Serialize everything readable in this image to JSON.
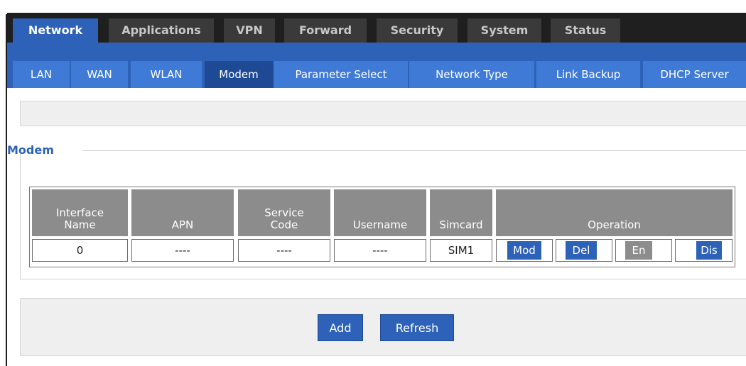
{
  "main_nav": {
    "tabs": [
      {
        "label": "Network",
        "active": true
      },
      {
        "label": "Applications",
        "active": false
      },
      {
        "label": "VPN",
        "active": false
      },
      {
        "label": "Forward",
        "active": false
      },
      {
        "label": "Security",
        "active": false
      },
      {
        "label": "System",
        "active": false
      },
      {
        "label": "Status",
        "active": false
      }
    ]
  },
  "sub_nav": {
    "tabs": [
      {
        "label": "LAN",
        "active": false
      },
      {
        "label": "WAN",
        "active": false
      },
      {
        "label": "WLAN",
        "active": false
      },
      {
        "label": "Modem",
        "active": true
      },
      {
        "label": "Parameter Select",
        "active": false
      },
      {
        "label": "Network Type",
        "active": false
      },
      {
        "label": "Link Backup",
        "active": false
      },
      {
        "label": "DHCP Server",
        "active": false
      }
    ]
  },
  "section": {
    "title": "Modem"
  },
  "table": {
    "headers": {
      "interface_name": "Interface\nName",
      "apn": "APN",
      "service_code": "Service\nCode",
      "username": "Username",
      "simcard": "Simcard",
      "operation": "Operation"
    },
    "rows": [
      {
        "interface_name": "0",
        "apn": "----",
        "service_code": "----",
        "username": "----",
        "simcard": "SIM1",
        "operations": {
          "mod": "Mod",
          "del": "Del",
          "en": "En",
          "dis": "Dis"
        }
      }
    ]
  },
  "actions": {
    "add_label": "Add",
    "refresh_label": "Refresh"
  },
  "colors": {
    "accent": "#2d62b8",
    "subnav": "#3f7bd6",
    "subnav_active": "#1e4a95",
    "topbar": "#1f1f1f",
    "header_gray": "#8c8c8c"
  }
}
